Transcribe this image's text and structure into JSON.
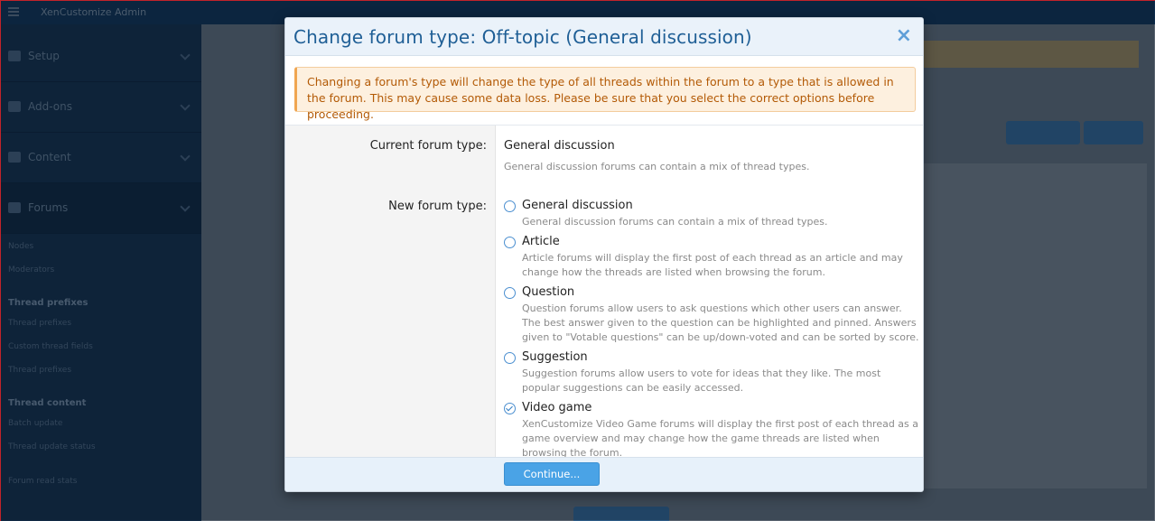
{
  "background": {
    "topbar_title": "XenCustomize Admin",
    "sidebar_sections": [
      {
        "label": "Setup"
      },
      {
        "label": "Add-ons"
      },
      {
        "label": "Content"
      },
      {
        "label": "Forums"
      }
    ],
    "sidebar_links": [
      {
        "label": "Nodes",
        "type": "link"
      },
      {
        "label": "Moderators",
        "type": "link"
      },
      {
        "label": "Thread prefixes",
        "type": "head"
      },
      {
        "label": "Thread prefixes",
        "type": "link"
      },
      {
        "label": "Custom thread fields",
        "type": "link"
      },
      {
        "label": "Thread prefixes",
        "type": "link"
      },
      {
        "label": "Thread content",
        "type": "head"
      },
      {
        "label": "Batch update",
        "type": "link"
      },
      {
        "label": "Thread update status",
        "type": "link"
      },
      {
        "label": "Forum read stats",
        "type": "link"
      }
    ]
  },
  "modal": {
    "title": "Change forum type: Off-topic (General discussion)",
    "close_icon": "×",
    "warning": "Changing a forum's type will change the type of all threads within the forum to a type that is allowed in the forum. This may cause some data loss. Please be sure that you select the correct options before proceeding.",
    "current_label": "Current forum type:",
    "current_value": "General discussion",
    "current_desc": "General discussion forums can contain a mix of thread types.",
    "new_label": "New forum type:",
    "options": [
      {
        "label": "General discussion",
        "desc": "General discussion forums can contain a mix of thread types.",
        "checked": false
      },
      {
        "label": "Article",
        "desc": "Article forums will display the first post of each thread as an article and may change how the threads are listed when browsing the forum.",
        "checked": false
      },
      {
        "label": "Question",
        "desc": "Question forums allow users to ask questions which other users can answer. The best answer given to the question can be highlighted and pinned. Answers given to \"Votable questions\" can be up/down-voted and can be sorted by score.",
        "checked": false
      },
      {
        "label": "Suggestion",
        "desc": "Suggestion forums allow users to vote for ideas that they like. The most popular suggestions can be easily accessed.",
        "checked": false
      },
      {
        "label": "Video game",
        "desc": "XenCustomize Video Game forums will display the first post of each thread as a game overview and may change how the game threads are listed when browsing the forum.",
        "checked": true
      }
    ],
    "continue_label": "Continue..."
  }
}
